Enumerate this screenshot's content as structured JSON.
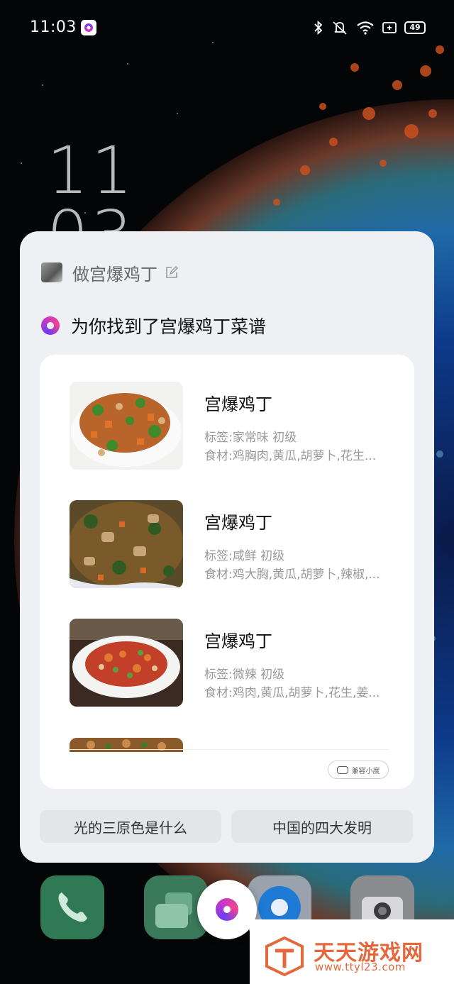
{
  "status_bar": {
    "time": "11:03",
    "battery": "49",
    "icons": [
      "bluetooth-icon",
      "mute-icon",
      "wifi-icon",
      "sim-icon",
      "battery-icon"
    ]
  },
  "lockscreen": {
    "clock_hours": "11",
    "clock_minutes": "03"
  },
  "assistant": {
    "query": "做宫爆鸡丁",
    "answer": "为你找到了宫爆鸡丁菜谱",
    "recipes": [
      {
        "title": "宫爆鸡丁",
        "tags": "标签:家常味 初级",
        "ingredients": "食材:鸡胸肉,黄瓜,胡萝卜,花生..."
      },
      {
        "title": "宫爆鸡丁",
        "tags": "标签:咸鲜 初级",
        "ingredients": "食材:鸡大胸,黄瓜,胡萝卜,辣椒,..."
      },
      {
        "title": "宫爆鸡丁",
        "tags": "标签:微辣 初级",
        "ingredients": "食材:鸡肉,黄瓜,胡萝卜,花生,姜..."
      }
    ],
    "source_badge": "兼容小度",
    "suggestions": [
      "光的三原色是什么",
      "中国的四大发明"
    ]
  },
  "watermark": {
    "name": "天天游戏网",
    "url": "www.ttyl23.com"
  },
  "colors": {
    "card_bg": "#eef0f3",
    "accent_gradient": [
      "#6d3cf0",
      "#c637c9",
      "#f0448f"
    ],
    "watermark": "#e4683c"
  }
}
